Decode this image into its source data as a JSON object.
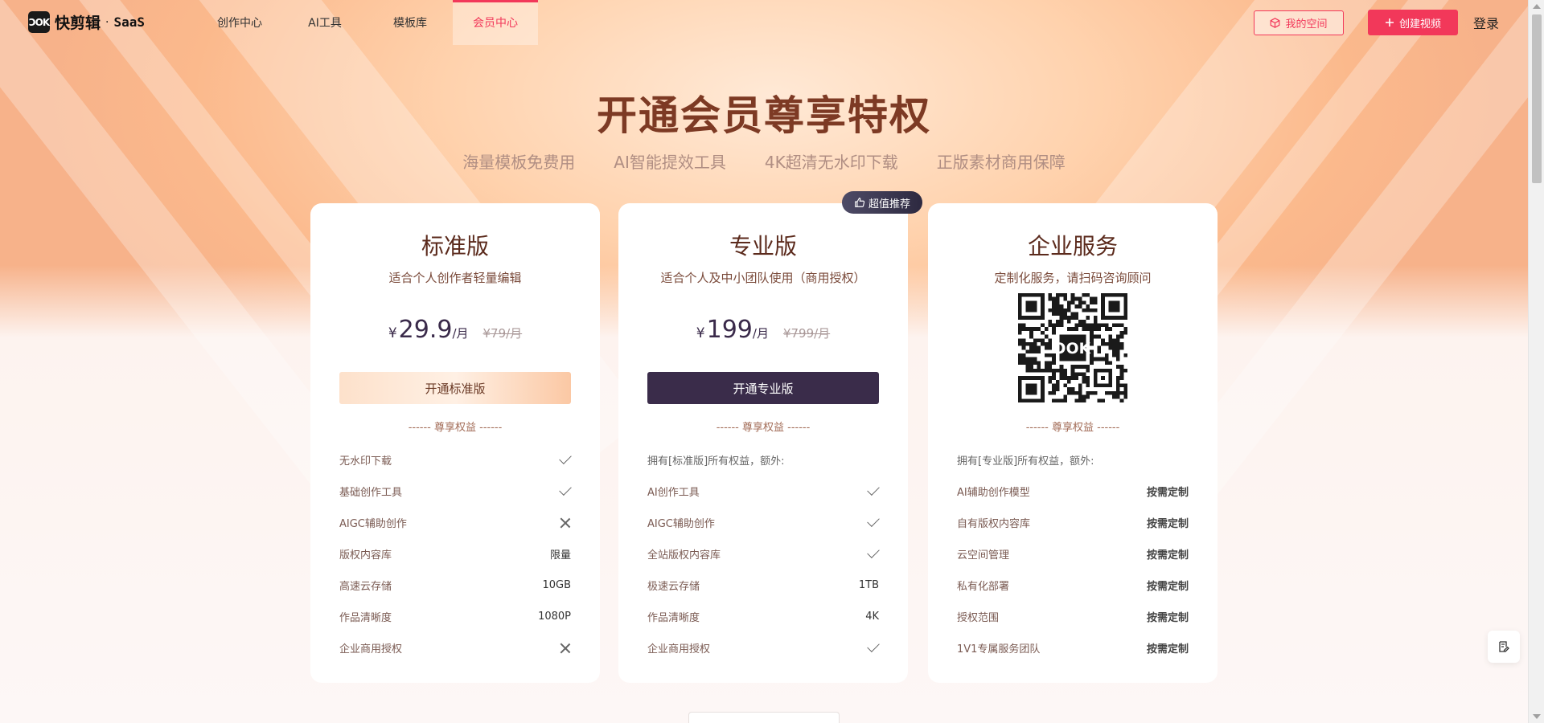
{
  "header": {
    "logo_mark": "ƆOK",
    "logo_text": "快剪辑",
    "logo_dot": "·",
    "logo_saas": "SaaS",
    "nav": [
      {
        "label": "创作中心",
        "active": false
      },
      {
        "label": "AI工具",
        "active": false
      },
      {
        "label": "模板库",
        "active": false
      },
      {
        "label": "会员中心",
        "active": true
      }
    ],
    "my_space_label": "我的空间",
    "create_video_label": "创建视频",
    "login_label": "登录"
  },
  "hero": {
    "title": "开通会员尊享特权",
    "features": [
      "海量模板免费用",
      "AI智能提效工具",
      "4K超清无水印下载",
      "正版素材商用保障"
    ]
  },
  "badge": {
    "label": "超值推荐"
  },
  "plans": [
    {
      "name": "标准版",
      "desc": "适合个人创作者轻量编辑",
      "currency": "¥",
      "price": "29.9",
      "unit": "/月",
      "orig": "¥79/月",
      "cta": "开通标准版",
      "perks_title": "------ 尊享权益 ------",
      "rows": [
        {
          "label": "无水印下载",
          "value": "",
          "mark": "check"
        },
        {
          "label": "基础创作工具",
          "value": "",
          "mark": "check"
        },
        {
          "label": "AIGC辅助创作",
          "value": "",
          "mark": "cross"
        },
        {
          "label": "版权内容库",
          "value": "限量",
          "mark": ""
        },
        {
          "label": "高速云存储",
          "value": "10GB",
          "mark": ""
        },
        {
          "label": "作品清晰度",
          "value": "1080P",
          "mark": ""
        },
        {
          "label": "企业商用授权",
          "value": "",
          "mark": "cross"
        }
      ]
    },
    {
      "name": "专业版",
      "desc": "适合个人及中小团队使用（商用授权）",
      "currency": "¥",
      "price": "199",
      "unit": "/月",
      "orig": "¥799/月",
      "cta": "开通专业版",
      "perks_title": "------ 尊享权益 ------",
      "head": "拥有[标准版]所有权益，额外:",
      "rows": [
        {
          "label": "AI创作工具",
          "value": "",
          "mark": "check"
        },
        {
          "label": "AIGC辅助创作",
          "value": "",
          "mark": "check"
        },
        {
          "label": "全站版权内容库",
          "value": "",
          "mark": "check"
        },
        {
          "label": "极速云存储",
          "value": "1TB",
          "mark": ""
        },
        {
          "label": "作品清晰度",
          "value": "4K",
          "mark": ""
        },
        {
          "label": "企业商用授权",
          "value": "",
          "mark": "check"
        }
      ]
    },
    {
      "name": "企业服务",
      "desc": "定制化服务，请扫码咨询顾问",
      "perks_title": "------ 尊享权益 ------",
      "head": "拥有[专业版]所有权益，额外:",
      "rows": [
        {
          "label": "AI辅助创作模型",
          "value": "按需定制"
        },
        {
          "label": "自有版权内容库",
          "value": "按需定制"
        },
        {
          "label": "云空间管理",
          "value": "按需定制"
        },
        {
          "label": "私有化部署",
          "value": "按需定制"
        },
        {
          "label": "授权范围",
          "value": "按需定制"
        },
        {
          "label": "1V1专属服务团队",
          "value": "按需定制"
        }
      ]
    }
  ],
  "colors": {
    "accent": "#f2385a",
    "title": "#7d3a24",
    "pro_button": "#3a2c4a"
  }
}
